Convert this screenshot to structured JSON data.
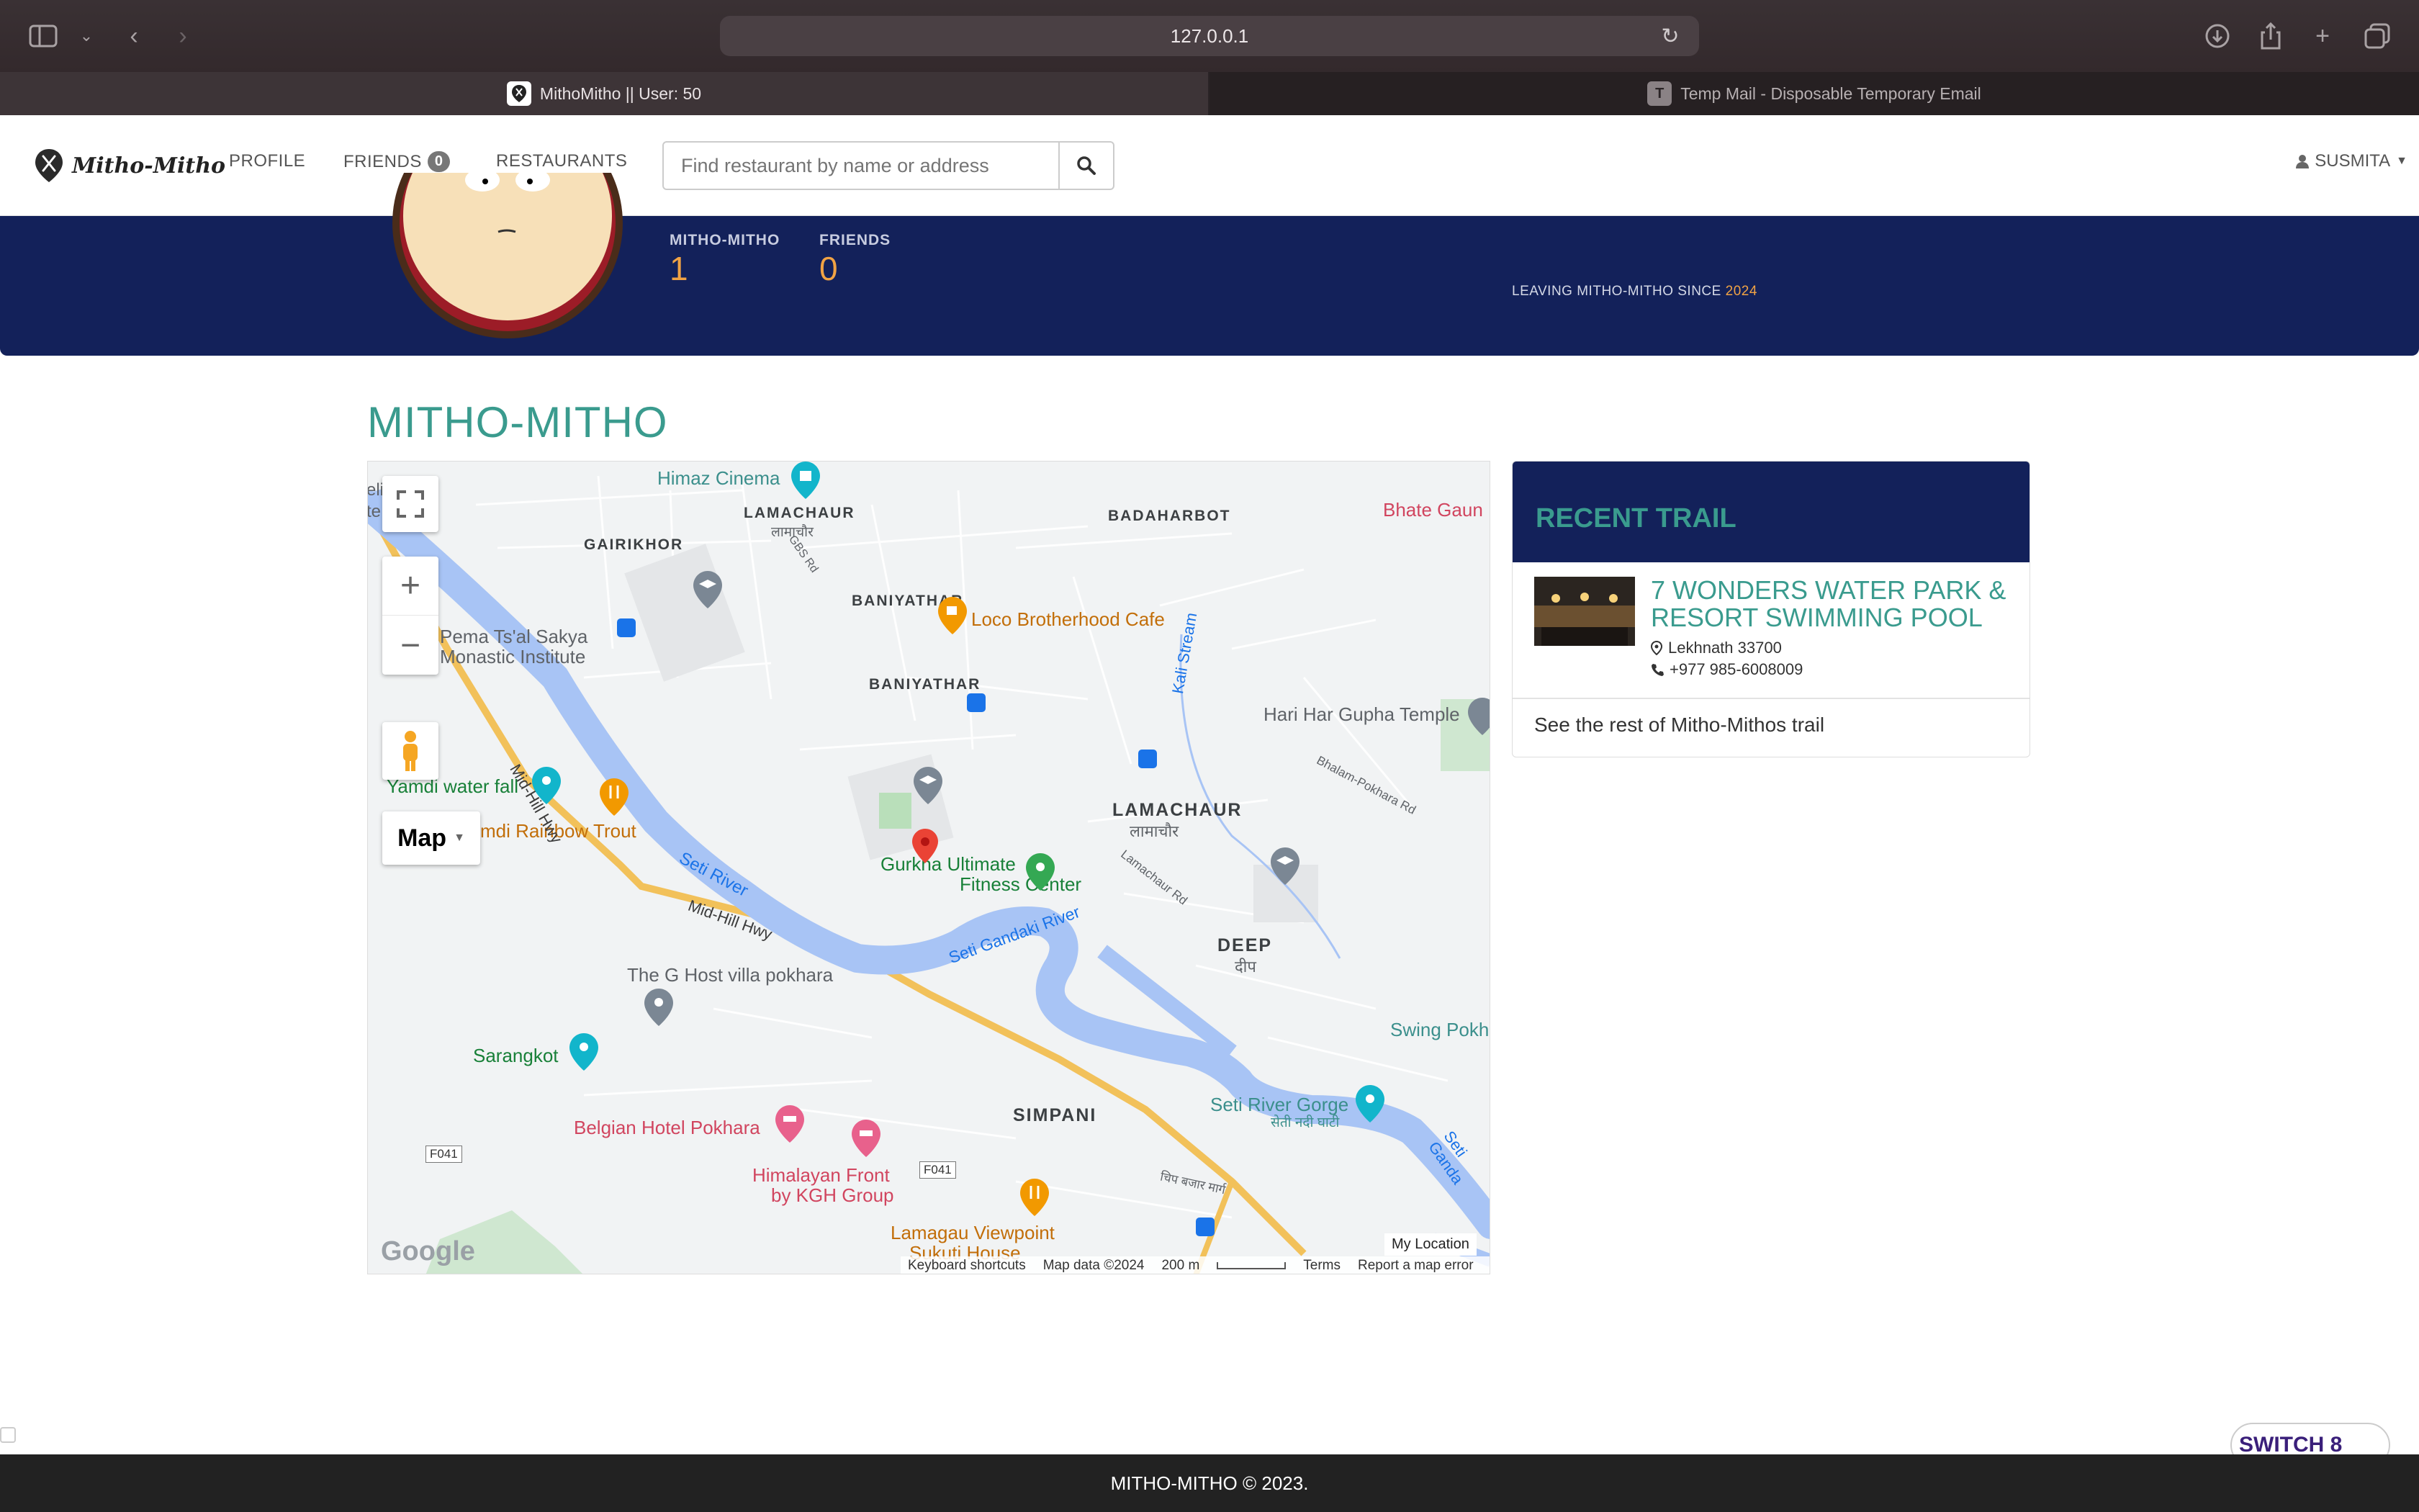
{
  "browser": {
    "url": "127.0.0.1",
    "tabs": [
      {
        "title": "MithoMitho || User: 50",
        "active": true
      },
      {
        "title": "Temp Mail - Disposable Temporary Email",
        "icon_letter": "T",
        "active": false
      }
    ]
  },
  "navbar": {
    "brand": "Mitho-Mitho",
    "links": {
      "profile": "PROFILE",
      "friends": "FRIENDS",
      "restaurants": "RESTAURANTS"
    },
    "friends_badge": "0",
    "search_placeholder": "Find restaurant by name or address",
    "user": "SUSMITA"
  },
  "profile": {
    "stats": [
      {
        "label": "MITHO-MITHO",
        "value": "1"
      },
      {
        "label": "FRIENDS",
        "value": "0"
      }
    ],
    "since_prefix": "LEAVING MITHO-MITHO SINCE",
    "since_year": "2024"
  },
  "section_title": "MITHO-MITHO",
  "map": {
    "type_button": "Map",
    "my_location": "My Location",
    "google": "Google",
    "footer": {
      "shortcuts": "Keyboard shortcuts",
      "data": "Map data ©2024",
      "scale": "200 m",
      "terms": "Terms",
      "report": "Report a map error"
    },
    "labels": {
      "himaz": "Himaz Cinema",
      "lamachaur_top": "LAMACHAUR",
      "lamachaur_top_np": "लामाचौर",
      "badaharbot": "BADAHARBOT",
      "bhate": "Bhate Gaun",
      "gairikhor": "GAIRIKHOR",
      "baniyathar1": "BANIYATHAR",
      "loco": "Loco Brotherhood Cafe",
      "pema": "Pema Ts'al Sakya",
      "monastic": "Monastic Institute",
      "baniyathar2": "BANIYATHAR",
      "kali": "Kali Stream",
      "harihar": "Hari Har Gupha Temple",
      "yamdi": "Yamdi water fall",
      "rainbow": "mdi Rainbow Trout",
      "lamachaur": "LAMACHAUR",
      "lamachaur_np": "लामाचौर",
      "gurkha": "Gurkha Ultimate",
      "fitness": "Fitness Center",
      "seti": "Seti River",
      "midhill1": "Mid-Hill Hwy",
      "midhill2": "Mid-Hill Hwy",
      "seti_gandaki": "Seti Gandaki River",
      "deep": "DEEP",
      "deep_np": "दीप",
      "ghost": "The G Host villa pokhara",
      "sarangkot": "Sarangkot",
      "swing": "Swing Pokh",
      "simpani": "SIMPANI",
      "gorge": "Seti River Gorge",
      "gorge_np": "सेती नदी घाटी",
      "belgian": "Belgian Hotel Pokhara",
      "himalayan1": "Himalayan Front",
      "himalayan2": "by KGH Group",
      "lamagau": "Lamagau Viewpoint",
      "sukuti": "Sukuti House",
      "f041a": "F041",
      "f041b": "F041",
      "gbs": "GBS Rd",
      "lamachaur_rd": "Lamachaur Rd",
      "bhalam": "Bhalam-Pokhara Rd",
      "eling": "eling",
      "te": "te",
      "chok": "चिप बजार मार्ग",
      "seti_ganda": "Seti Ganda"
    }
  },
  "recent_trail": {
    "heading": "RECENT TRAIL",
    "name": "7 WONDERS WATER PARK & RESORT SWIMMING POOL",
    "address": "Lekhnath 33700",
    "phone": "+977 985-6008009",
    "see_rest": "See the rest of Mitho-Mithos trail"
  },
  "footer": "MITHO-MITHO © 2023.",
  "switch_button": "SWITCH 8"
}
